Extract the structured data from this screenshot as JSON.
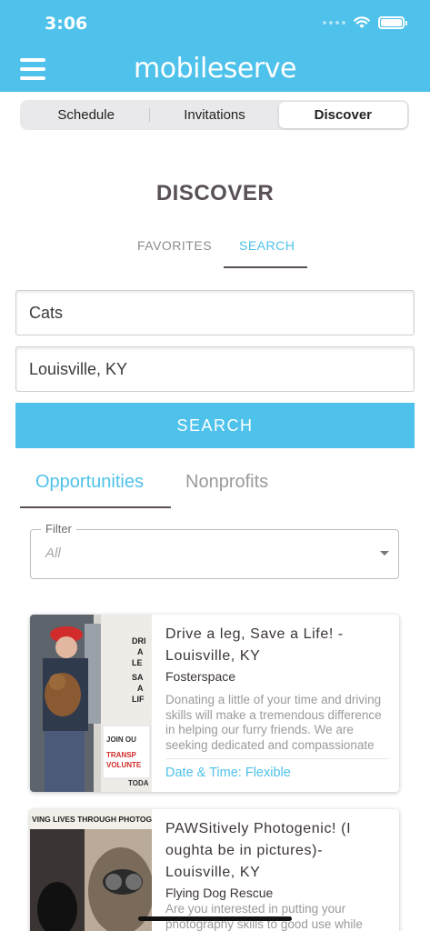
{
  "status_bar": {
    "time": "3:06"
  },
  "app": {
    "brand": "mobileserve"
  },
  "segments": [
    {
      "label": "Schedule",
      "active": false
    },
    {
      "label": "Invitations",
      "active": false
    },
    {
      "label": "Discover",
      "active": true
    }
  ],
  "page": {
    "title": "DISCOVER"
  },
  "subtabs": {
    "favorites": "FAVORITES",
    "search": "SEARCH",
    "active": "search"
  },
  "search_form": {
    "keyword_value": "Cats",
    "location_value": "Louisville, KY",
    "button_label": "SEARCH"
  },
  "result_tabs": {
    "opportunities": "Opportunities",
    "nonprofits": "Nonprofits",
    "active": "opportunities"
  },
  "filter": {
    "label": "Filter",
    "value": "All"
  },
  "results": [
    {
      "title": "Drive a leg, Save a Life! - Louisville, KY",
      "org": "Fosterspace",
      "description": "Donating a little of your time and driving skills will make a tremendous difference in helping our furry friends. We are seeking dedicated and compassionate",
      "date": "Date & Time: Flexible",
      "image_text": [
        "DRI",
        "A",
        "LE",
        "SA",
        "A",
        "LIF",
        "JOIN OU",
        "TRANSP",
        "VOLUNTE",
        "TODA"
      ]
    },
    {
      "title": "PAWSitively Photogenic! (I oughta be in pictures)- Louisville, KY",
      "org": "Flying Dog Rescue",
      "description": "Are you interested in putting your photography skills to good use while",
      "image_text": [
        "VING LIVES THROUGH PHOTOGRA"
      ]
    }
  ],
  "colors": {
    "accent": "#4ec2ea",
    "title": "#5a5057",
    "muted": "#9a9a9a"
  }
}
